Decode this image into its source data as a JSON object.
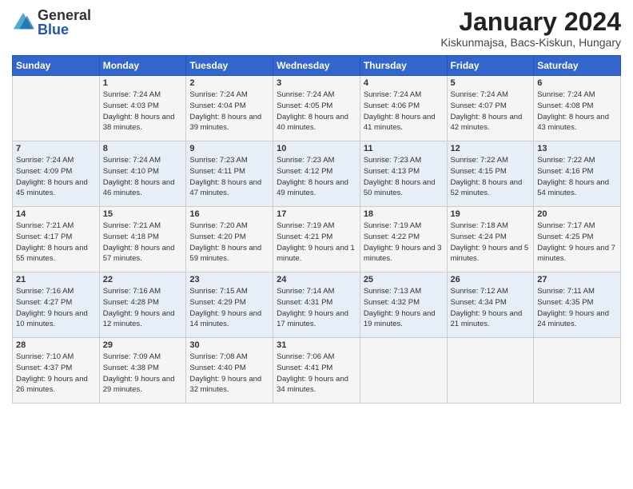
{
  "header": {
    "logo_general": "General",
    "logo_blue": "Blue",
    "title": "January 2024",
    "subtitle": "Kiskunmajsa, Bacs-Kiskun, Hungary"
  },
  "days_of_week": [
    "Sunday",
    "Monday",
    "Tuesday",
    "Wednesday",
    "Thursday",
    "Friday",
    "Saturday"
  ],
  "weeks": [
    [
      {
        "day": "",
        "sunrise": "",
        "sunset": "",
        "daylight": ""
      },
      {
        "day": "1",
        "sunrise": "Sunrise: 7:24 AM",
        "sunset": "Sunset: 4:03 PM",
        "daylight": "Daylight: 8 hours and 38 minutes."
      },
      {
        "day": "2",
        "sunrise": "Sunrise: 7:24 AM",
        "sunset": "Sunset: 4:04 PM",
        "daylight": "Daylight: 8 hours and 39 minutes."
      },
      {
        "day": "3",
        "sunrise": "Sunrise: 7:24 AM",
        "sunset": "Sunset: 4:05 PM",
        "daylight": "Daylight: 8 hours and 40 minutes."
      },
      {
        "day": "4",
        "sunrise": "Sunrise: 7:24 AM",
        "sunset": "Sunset: 4:06 PM",
        "daylight": "Daylight: 8 hours and 41 minutes."
      },
      {
        "day": "5",
        "sunrise": "Sunrise: 7:24 AM",
        "sunset": "Sunset: 4:07 PM",
        "daylight": "Daylight: 8 hours and 42 minutes."
      },
      {
        "day": "6",
        "sunrise": "Sunrise: 7:24 AM",
        "sunset": "Sunset: 4:08 PM",
        "daylight": "Daylight: 8 hours and 43 minutes."
      }
    ],
    [
      {
        "day": "7",
        "sunrise": "Sunrise: 7:24 AM",
        "sunset": "Sunset: 4:09 PM",
        "daylight": "Daylight: 8 hours and 45 minutes."
      },
      {
        "day": "8",
        "sunrise": "Sunrise: 7:24 AM",
        "sunset": "Sunset: 4:10 PM",
        "daylight": "Daylight: 8 hours and 46 minutes."
      },
      {
        "day": "9",
        "sunrise": "Sunrise: 7:23 AM",
        "sunset": "Sunset: 4:11 PM",
        "daylight": "Daylight: 8 hours and 47 minutes."
      },
      {
        "day": "10",
        "sunrise": "Sunrise: 7:23 AM",
        "sunset": "Sunset: 4:12 PM",
        "daylight": "Daylight: 8 hours and 49 minutes."
      },
      {
        "day": "11",
        "sunrise": "Sunrise: 7:23 AM",
        "sunset": "Sunset: 4:13 PM",
        "daylight": "Daylight: 8 hours and 50 minutes."
      },
      {
        "day": "12",
        "sunrise": "Sunrise: 7:22 AM",
        "sunset": "Sunset: 4:15 PM",
        "daylight": "Daylight: 8 hours and 52 minutes."
      },
      {
        "day": "13",
        "sunrise": "Sunrise: 7:22 AM",
        "sunset": "Sunset: 4:16 PM",
        "daylight": "Daylight: 8 hours and 54 minutes."
      }
    ],
    [
      {
        "day": "14",
        "sunrise": "Sunrise: 7:21 AM",
        "sunset": "Sunset: 4:17 PM",
        "daylight": "Daylight: 8 hours and 55 minutes."
      },
      {
        "day": "15",
        "sunrise": "Sunrise: 7:21 AM",
        "sunset": "Sunset: 4:18 PM",
        "daylight": "Daylight: 8 hours and 57 minutes."
      },
      {
        "day": "16",
        "sunrise": "Sunrise: 7:20 AM",
        "sunset": "Sunset: 4:20 PM",
        "daylight": "Daylight: 8 hours and 59 minutes."
      },
      {
        "day": "17",
        "sunrise": "Sunrise: 7:19 AM",
        "sunset": "Sunset: 4:21 PM",
        "daylight": "Daylight: 9 hours and 1 minute."
      },
      {
        "day": "18",
        "sunrise": "Sunrise: 7:19 AM",
        "sunset": "Sunset: 4:22 PM",
        "daylight": "Daylight: 9 hours and 3 minutes."
      },
      {
        "day": "19",
        "sunrise": "Sunrise: 7:18 AM",
        "sunset": "Sunset: 4:24 PM",
        "daylight": "Daylight: 9 hours and 5 minutes."
      },
      {
        "day": "20",
        "sunrise": "Sunrise: 7:17 AM",
        "sunset": "Sunset: 4:25 PM",
        "daylight": "Daylight: 9 hours and 7 minutes."
      }
    ],
    [
      {
        "day": "21",
        "sunrise": "Sunrise: 7:16 AM",
        "sunset": "Sunset: 4:27 PM",
        "daylight": "Daylight: 9 hours and 10 minutes."
      },
      {
        "day": "22",
        "sunrise": "Sunrise: 7:16 AM",
        "sunset": "Sunset: 4:28 PM",
        "daylight": "Daylight: 9 hours and 12 minutes."
      },
      {
        "day": "23",
        "sunrise": "Sunrise: 7:15 AM",
        "sunset": "Sunset: 4:29 PM",
        "daylight": "Daylight: 9 hours and 14 minutes."
      },
      {
        "day": "24",
        "sunrise": "Sunrise: 7:14 AM",
        "sunset": "Sunset: 4:31 PM",
        "daylight": "Daylight: 9 hours and 17 minutes."
      },
      {
        "day": "25",
        "sunrise": "Sunrise: 7:13 AM",
        "sunset": "Sunset: 4:32 PM",
        "daylight": "Daylight: 9 hours and 19 minutes."
      },
      {
        "day": "26",
        "sunrise": "Sunrise: 7:12 AM",
        "sunset": "Sunset: 4:34 PM",
        "daylight": "Daylight: 9 hours and 21 minutes."
      },
      {
        "day": "27",
        "sunrise": "Sunrise: 7:11 AM",
        "sunset": "Sunset: 4:35 PM",
        "daylight": "Daylight: 9 hours and 24 minutes."
      }
    ],
    [
      {
        "day": "28",
        "sunrise": "Sunrise: 7:10 AM",
        "sunset": "Sunset: 4:37 PM",
        "daylight": "Daylight: 9 hours and 26 minutes."
      },
      {
        "day": "29",
        "sunrise": "Sunrise: 7:09 AM",
        "sunset": "Sunset: 4:38 PM",
        "daylight": "Daylight: 9 hours and 29 minutes."
      },
      {
        "day": "30",
        "sunrise": "Sunrise: 7:08 AM",
        "sunset": "Sunset: 4:40 PM",
        "daylight": "Daylight: 9 hours and 32 minutes."
      },
      {
        "day": "31",
        "sunrise": "Sunrise: 7:06 AM",
        "sunset": "Sunset: 4:41 PM",
        "daylight": "Daylight: 9 hours and 34 minutes."
      },
      {
        "day": "",
        "sunrise": "",
        "sunset": "",
        "daylight": ""
      },
      {
        "day": "",
        "sunrise": "",
        "sunset": "",
        "daylight": ""
      },
      {
        "day": "",
        "sunrise": "",
        "sunset": "",
        "daylight": ""
      }
    ]
  ]
}
